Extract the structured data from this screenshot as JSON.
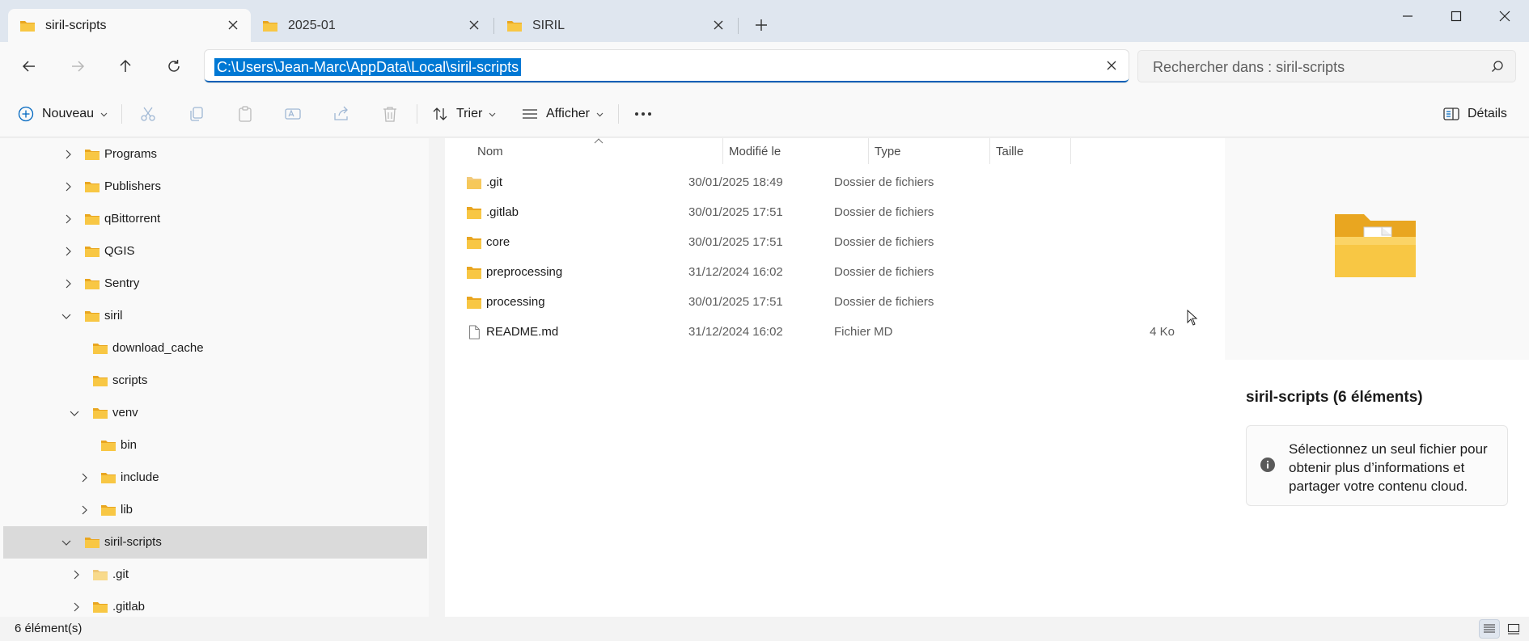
{
  "tabs": [
    {
      "label": "siril-scripts",
      "active": true
    },
    {
      "label": "2025-01",
      "active": false
    },
    {
      "label": "SIRIL",
      "active": false
    }
  ],
  "address": {
    "path": "C:\\Users\\Jean-Marc\\AppData\\Local\\siril-scripts"
  },
  "search": {
    "placeholder": "Rechercher dans : siril-scripts"
  },
  "toolbar": {
    "new_label": "Nouveau",
    "sort_label": "Trier",
    "view_label": "Afficher",
    "details_label": "Détails"
  },
  "nav_tree": [
    {
      "label": "Programs",
      "expanded": false
    },
    {
      "label": "Publishers",
      "expanded": false
    },
    {
      "label": "qBittorrent",
      "expanded": false
    },
    {
      "label": "QGIS",
      "expanded": false
    },
    {
      "label": "Sentry",
      "expanded": false
    },
    {
      "label": "siril",
      "expanded": true
    },
    {
      "label": "download_cache"
    },
    {
      "label": "scripts"
    },
    {
      "label": "venv",
      "expanded": true
    },
    {
      "label": "bin"
    },
    {
      "label": "include",
      "expanded": false
    },
    {
      "label": "lib",
      "expanded": false
    },
    {
      "label": "siril-scripts",
      "expanded": true,
      "selected": true
    },
    {
      "label": ".git",
      "expanded": false
    },
    {
      "label": ".gitlab",
      "expanded": false
    }
  ],
  "columns": {
    "name": "Nom",
    "modified": "Modifié le",
    "type": "Type",
    "size": "Taille"
  },
  "files": [
    {
      "name": ".git",
      "modified": "30/01/2025 18:49",
      "type": "Dossier de fichiers",
      "size": "",
      "kind": "folder"
    },
    {
      "name": ".gitlab",
      "modified": "30/01/2025 17:51",
      "type": "Dossier de fichiers",
      "size": "",
      "kind": "folder"
    },
    {
      "name": "core",
      "modified": "30/01/2025 17:51",
      "type": "Dossier de fichiers",
      "size": "",
      "kind": "folder"
    },
    {
      "name": "preprocessing",
      "modified": "31/12/2024 16:02",
      "type": "Dossier de fichiers",
      "size": "",
      "kind": "folder"
    },
    {
      "name": "processing",
      "modified": "30/01/2025 17:51",
      "type": "Dossier de fichiers",
      "size": "",
      "kind": "folder"
    },
    {
      "name": "README.md",
      "modified": "31/12/2024 16:02",
      "type": "Fichier MD",
      "size": "4 Ko",
      "kind": "file"
    }
  ],
  "details": {
    "title": "siril-scripts (6 éléments)",
    "info": "Sélectionnez un seul fichier pour obtenir plus d’informations et partager votre contenu cloud."
  },
  "status": {
    "count": "6 élément(s)"
  },
  "colors": {
    "accent": "#0078d4",
    "folder": "#f8c744",
    "folder_dark": "#e9a620",
    "tabbar": "#dfe6ef"
  }
}
